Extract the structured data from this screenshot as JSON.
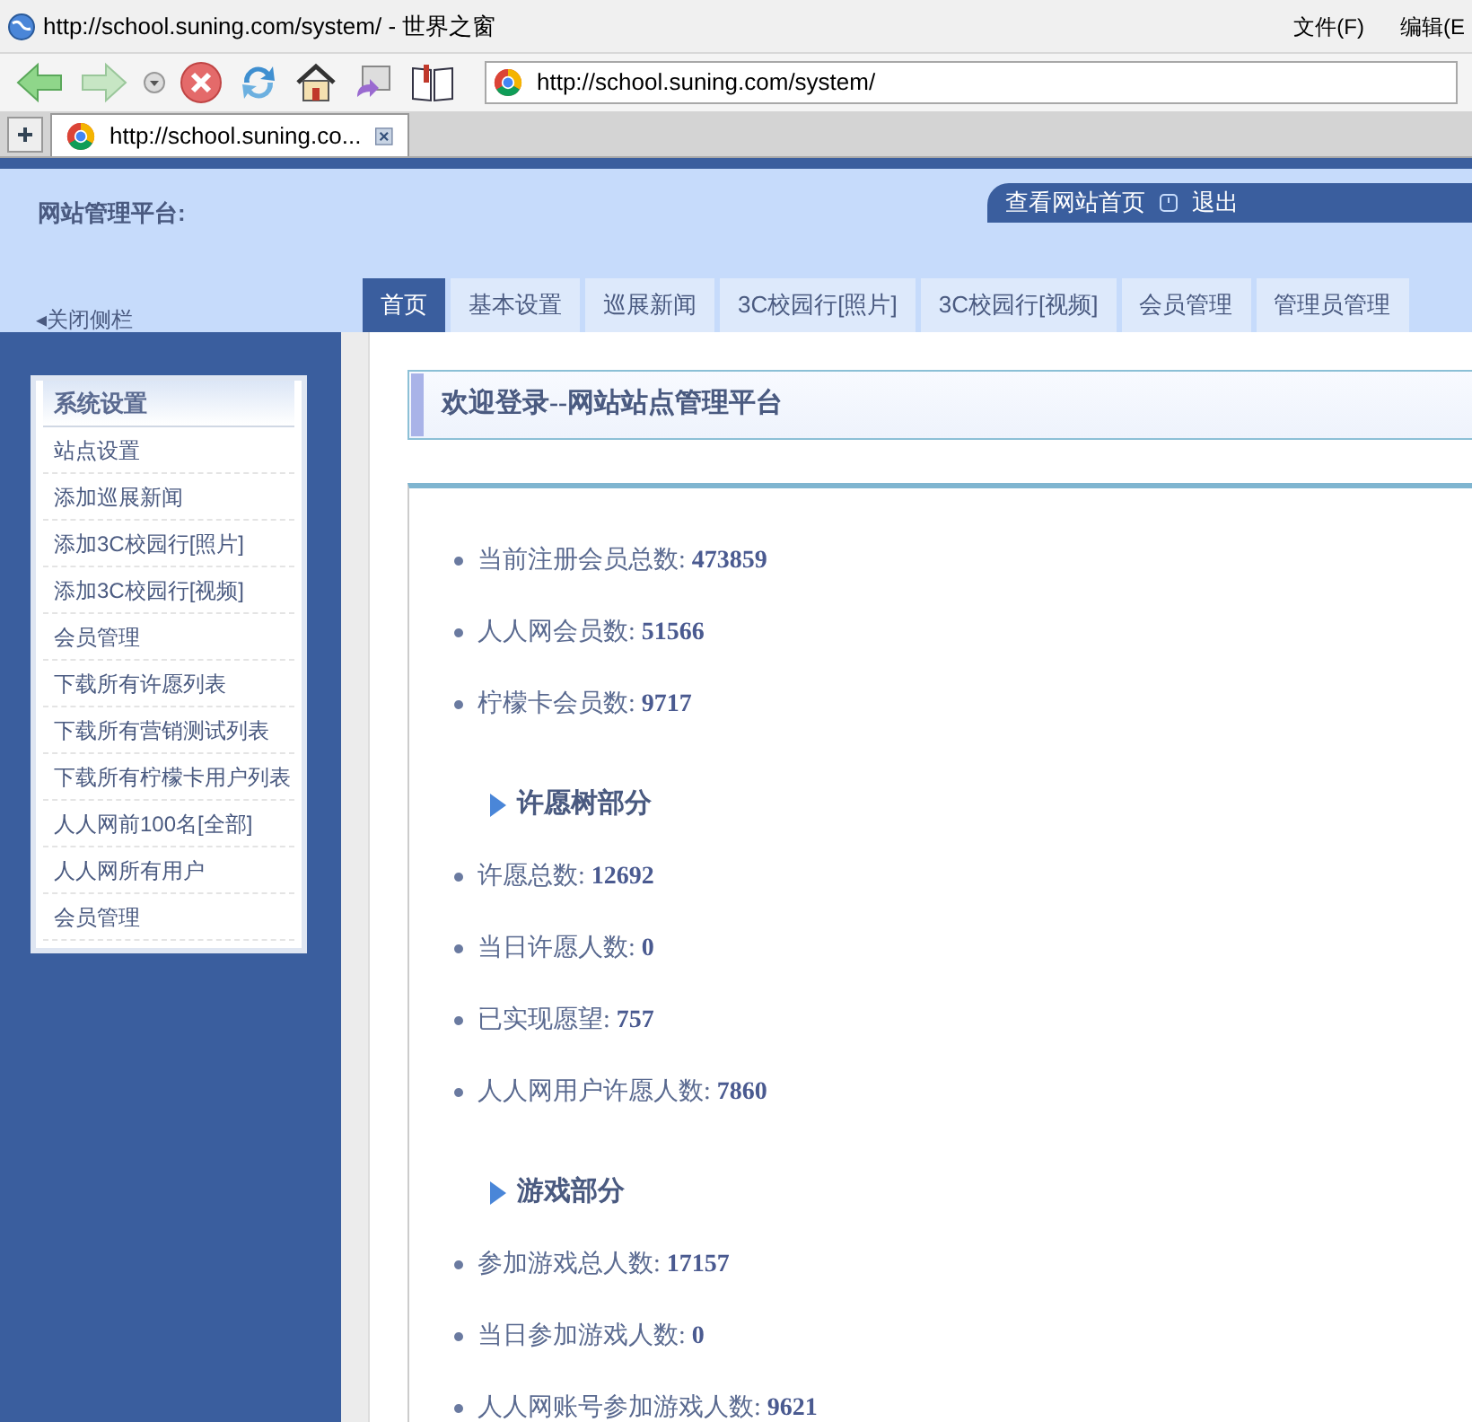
{
  "window": {
    "title": "http://school.suning.com/system/ - 世界之窗",
    "menu": [
      "文件(F)",
      "编辑(E"
    ]
  },
  "address_bar": {
    "value": "http://school.suning.com/system/"
  },
  "browser_tabs": [
    {
      "label": "http://school.suning.co...",
      "selected": true
    }
  ],
  "header": {
    "title": "网站管理平台:",
    "links": [
      "查看网站首页",
      "退出"
    ],
    "collapse_link": "◂关闭侧栏"
  },
  "nav_tabs": [
    {
      "label": "首页",
      "selected": true
    },
    {
      "label": "基本设置",
      "selected": false
    },
    {
      "label": "巡展新闻",
      "selected": false
    },
    {
      "label": "3C校园行[照片]",
      "selected": false
    },
    {
      "label": "3C校园行[视频]",
      "selected": false
    },
    {
      "label": "会员管理",
      "selected": false
    },
    {
      "label": "管理员管理",
      "selected": false
    }
  ],
  "sidebar": {
    "title": "系统设置",
    "items": [
      "站点设置",
      "添加巡展新闻",
      "添加3C校园行[照片]",
      "添加3C校园行[视频]",
      "会员管理",
      "下载所有许愿列表",
      "下载所有营销测试列表",
      "下载所有柠檬卡用户列表",
      "人人网前100名[全部]",
      "人人网所有用户",
      "会员管理"
    ]
  },
  "main": {
    "title": "欢迎登录--网站站点管理平台",
    "sections": [
      {
        "items": [
          {
            "label": "当前注册会员总数:",
            "value": "473859"
          },
          {
            "label": "人人网会员数:",
            "value": "51566"
          },
          {
            "label": "柠檬卡会员数:",
            "value": "9717"
          }
        ]
      },
      {
        "heading": "许愿树部分",
        "items": [
          {
            "label": "许愿总数:",
            "value": "12692"
          },
          {
            "label": "当日许愿人数:",
            "value": "0"
          },
          {
            "label": "已实现愿望:",
            "value": "757"
          },
          {
            "label": "人人网用户许愿人数:",
            "value": "7860"
          }
        ]
      },
      {
        "heading": "游戏部分",
        "items": [
          {
            "label": "参加游戏总人数:",
            "value": "17157"
          },
          {
            "label": "当日参加游戏人数:",
            "value": "0"
          },
          {
            "label": "人人网账号参加游戏人数:",
            "value": "9621"
          }
        ]
      }
    ]
  }
}
